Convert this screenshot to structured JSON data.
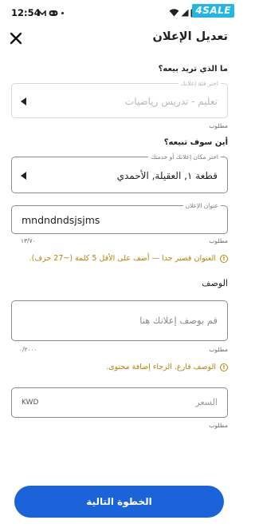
{
  "status_bar": {
    "time": "12:54",
    "brand": "4SALE",
    "icons": [
      "m-notification-icon",
      "gamepad-icon",
      "dot-icon",
      "wifi-icon",
      "signal-icon",
      "battery-icon"
    ]
  },
  "app_bar": {
    "title": "تعديل الإعلان",
    "close_icon": "close-icon"
  },
  "category_section": {
    "label": "ما الذي تريد بيعه؟",
    "floating_label": "اختر فئة إعلانك",
    "value": "تعليم - تدريس رياضيات",
    "helper": "مطلوب"
  },
  "location_section": {
    "label": "أين سوف تبيعه؟",
    "floating_label": "اختر مكان إعلانك أو خدمتك",
    "value": "قطعة ١, العقيلة, الأحمدي"
  },
  "title_field": {
    "floating_label": "عنوان الإعلان",
    "value": "mndndndsjsjms",
    "helper": "مطلوب",
    "counter": "١٣/٧٠",
    "warning": "العنوان قصير جدا — أضف على الأقل 5 كلمة (~27 حرف)."
  },
  "description_field": {
    "label": "الوصف",
    "placeholder": "قم بوصف إعلانك هنا",
    "helper": "مطلوب",
    "counter": "٠/٢٠٠٠",
    "warning": "الوصف فارغ. الرجاء إضافة محتوى."
  },
  "price_field": {
    "placeholder": "السعر",
    "currency": "KWD",
    "helper": "مطلوب"
  },
  "footer": {
    "next_button": "الخطوة التالية"
  },
  "colors": {
    "primary": "#1a63d8",
    "warning": "#b7830a",
    "brand": "#20b7e6"
  }
}
